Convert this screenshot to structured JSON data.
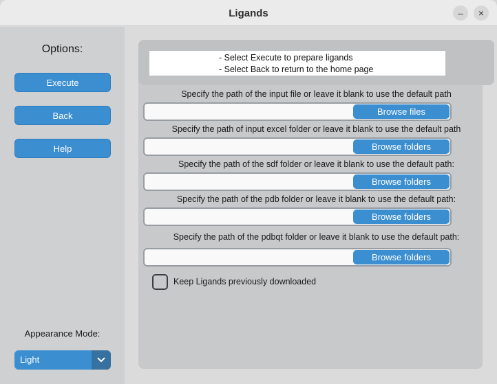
{
  "window": {
    "title": "Ligands",
    "minimize_glyph": "–",
    "close_glyph": "×"
  },
  "sidebar": {
    "title": "Options:",
    "buttons": [
      "Execute",
      "Back",
      "Help"
    ],
    "appearance_label": "Appearance Mode:",
    "appearance_value": "Light"
  },
  "info": {
    "lines": [
      "- Select Execute to prepare ligands",
      "- Select Back to return to the home page"
    ]
  },
  "paths": [
    {
      "label": "Specify the path of the input file or leave it blank to use the default path",
      "value": "",
      "button": "Browse files"
    },
    {
      "label": "Specify the path of input excel folder or leave it blank to use the default path",
      "value": "",
      "button": "Browse folders"
    },
    {
      "label": "Specify the path of the sdf folder or leave it blank to use the default path:",
      "value": "",
      "button": "Browse folders"
    },
    {
      "label": "Specify the path of the pdb folder or leave it blank to use the default path:",
      "value": "",
      "button": "Browse folders"
    },
    {
      "label": "Specify the path of the pdbqt folder or leave it blank to use the default path:",
      "value": "",
      "button": "Browse folders"
    }
  ],
  "keep_ligands": {
    "label": "Keep Ligands previously downloaded",
    "checked": false
  },
  "colors": {
    "accent": "#3b8ed0",
    "accent_dark": "#36719f",
    "sidebar_bg": "#cfd0d2",
    "main_bg": "#c8c9cb"
  }
}
